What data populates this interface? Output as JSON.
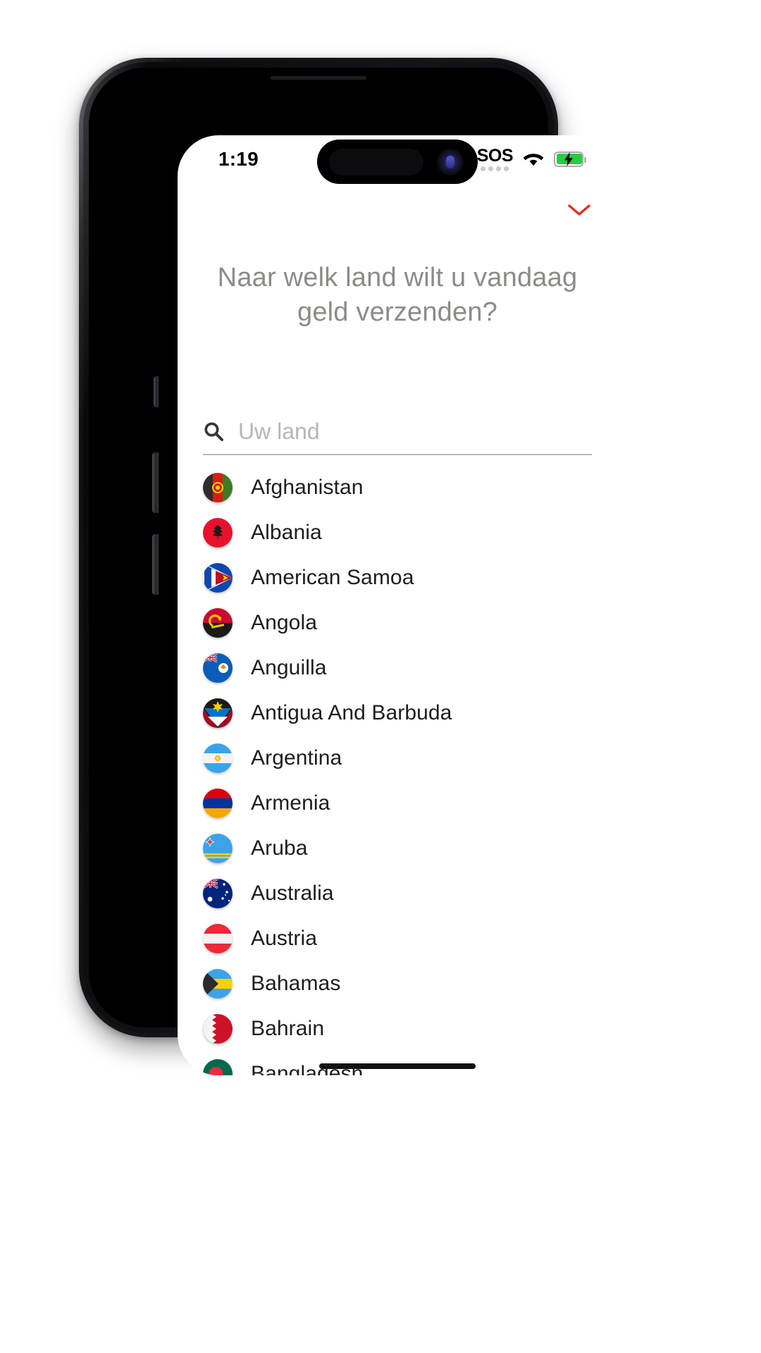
{
  "status_bar": {
    "time": "1:19",
    "sos_label": "SOS",
    "signal_dots": 4,
    "wifi_icon": "wifi-icon",
    "battery_icon": "battery-charging-icon",
    "battery_color": "#27cc41",
    "battery_charging": true
  },
  "header": {
    "collapse_icon": "chevron-down-icon",
    "collapse_icon_color": "#e0301e",
    "title": "Naar welk land wilt u vandaag geld verzenden?"
  },
  "search": {
    "icon": "search-icon",
    "placeholder": "Uw land",
    "value": ""
  },
  "country_list": [
    {
      "name": "Afghanistan",
      "flag": "af"
    },
    {
      "name": "Albania",
      "flag": "al"
    },
    {
      "name": "American Samoa",
      "flag": "as"
    },
    {
      "name": "Angola",
      "flag": "ao"
    },
    {
      "name": "Anguilla",
      "flag": "ai"
    },
    {
      "name": "Antigua And Barbuda",
      "flag": "ag"
    },
    {
      "name": "Argentina",
      "flag": "ar"
    },
    {
      "name": "Armenia",
      "flag": "am"
    },
    {
      "name": "Aruba",
      "flag": "aw"
    },
    {
      "name": "Australia",
      "flag": "au"
    },
    {
      "name": "Austria",
      "flag": "at"
    },
    {
      "name": "Bahamas",
      "flag": "bs"
    },
    {
      "name": "Bahrain",
      "flag": "bh"
    },
    {
      "name": "Bangladesh",
      "flag": "bd"
    }
  ]
}
